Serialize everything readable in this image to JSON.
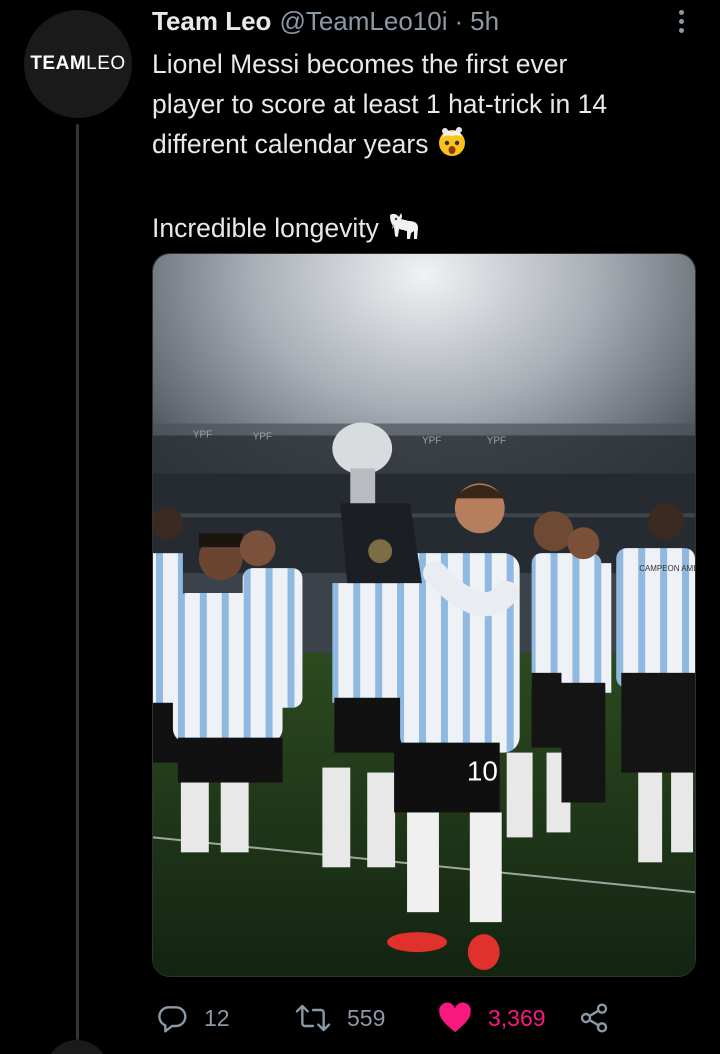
{
  "avatar": {
    "text_bold": "TEAM",
    "text_light": "LEO"
  },
  "tweet": {
    "display_name": "Team Leo",
    "handle": "@TeamLeo10i",
    "separator": "·",
    "time": "5h",
    "text_line1": "Lionel Messi becomes the first ever",
    "text_line2": "player to score at least 1 hat-trick in 14",
    "text_line3": "different calendar years",
    "text_line4": "Incredible longevity",
    "emoji1": "shocked-face-exploding-head",
    "emoji2": "goat"
  },
  "media": {
    "description_icon": "photo-trophy-celebration",
    "jersey_number": "10",
    "shirt_banner": "CAMPEON AMERICA",
    "stadium_ad": "YPF"
  },
  "actions": {
    "reply_count": "12",
    "retweet_count": "559",
    "like_count": "3,369"
  },
  "colors": {
    "background": "#000000",
    "text": "#e7e9ea",
    "muted": "#8b98a5",
    "like": "#f91880",
    "thread_line": "#333639"
  }
}
